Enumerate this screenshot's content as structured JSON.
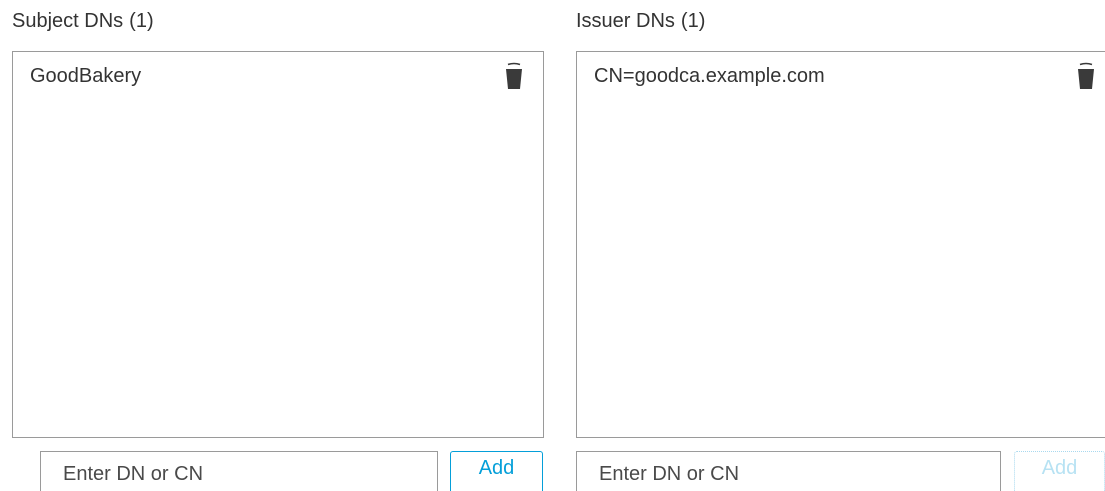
{
  "subject": {
    "title": "Subject DNs",
    "count": "(1)",
    "items": [
      {
        "label": "GoodBakery"
      }
    ],
    "input_placeholder": "Enter DN or CN",
    "add_label": "Add"
  },
  "issuer": {
    "title": "Issuer DNs",
    "count": "(1)",
    "items": [
      {
        "label": "CN=goodca.example.com"
      }
    ],
    "input_placeholder": "Enter DN or CN",
    "add_label": "Add"
  },
  "icons": {
    "delete": "trash-icon"
  },
  "colors": {
    "accent": "#049fd9",
    "accent_disabled": "#b7e2f3",
    "border": "#9a9a9a",
    "text": "#333333"
  }
}
